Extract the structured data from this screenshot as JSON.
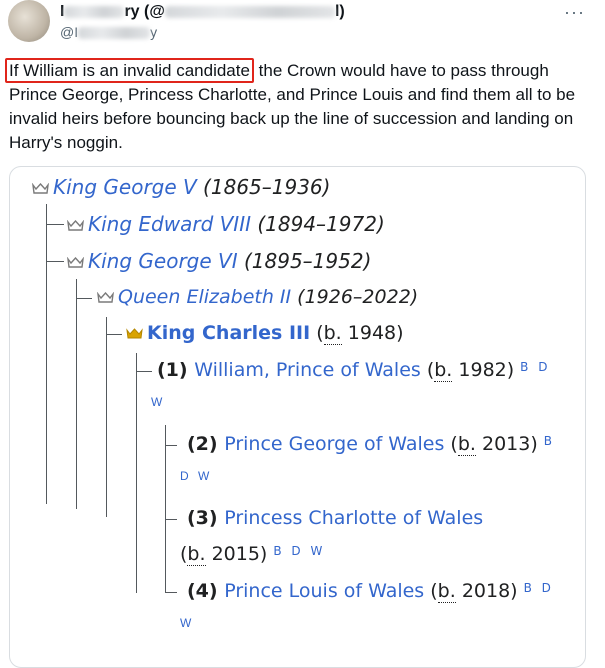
{
  "tweet": {
    "display_name_visible_start": "I",
    "display_name_visible_mid": "ry (@",
    "display_name_visible_end": "l)",
    "handle_visible_start": "@I",
    "handle_visible_end": "y",
    "more_label": "···",
    "highlighted_text": "If William is an invalid candidate",
    "body_text": " the Crown would have to pass through Prince George, Princess Charlotte, and Prince Louis and find them all to be invalid heirs before bouncing back up the line of succession and landing on Harry's noggin."
  },
  "tree": {
    "george_v": {
      "name": "King George V",
      "years": " (1865–1936)"
    },
    "edward_viii": {
      "name": "King Edward VIII",
      "years": " (1894–1972)"
    },
    "george_vi": {
      "name": "King George VI",
      "years": " (1895–1952)"
    },
    "elizabeth_ii": {
      "name": "Queen Elizabeth II",
      "years": " (1926–2022)"
    },
    "charles_iii": {
      "name": "King Charles III",
      "pre": " (",
      "born_abbr": "b.",
      "year": " 1948)"
    },
    "william": {
      "num": "(1) ",
      "name": "William, Prince of Wales",
      "pre": " (",
      "born_abbr": "b.",
      "year": " 1982)",
      "sup": "B D",
      "cont": "W"
    },
    "george": {
      "num": "(2) ",
      "name": "Prince George of Wales",
      "pre": " (",
      "born_abbr": "b.",
      "year": " 2013)",
      "sup": "B",
      "cont": "D W"
    },
    "charlotte": {
      "num": "(3) ",
      "name": "Princess Charlotte of Wales",
      "pre": "(",
      "born_abbr": "b.",
      "year": " 2015)",
      "sup": "B D W"
    },
    "louis": {
      "num": "(4) ",
      "name": "Prince Louis of Wales",
      "pre": " (",
      "born_abbr": "b.",
      "year": " 2018)",
      "sup": "B D",
      "cont": "W"
    }
  },
  "colors": {
    "link": "#3366cc",
    "highlight_border": "#e0251b",
    "crown_gray": "#7a7a7a",
    "crown_gold": "#d9a300",
    "tree_line": "#54595d"
  }
}
